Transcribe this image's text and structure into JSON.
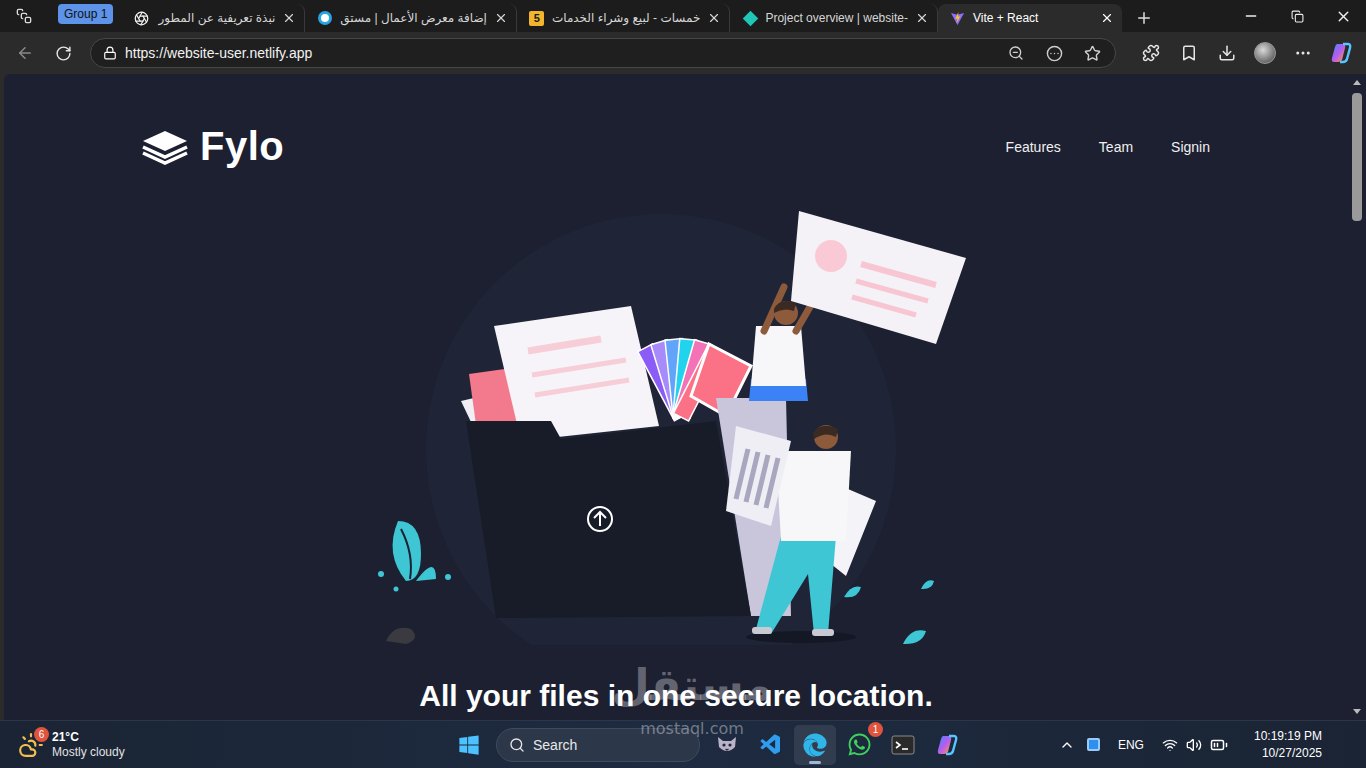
{
  "browser": {
    "tab_group": "Group 1",
    "tabs": [
      {
        "label": "نبذة تعريفية عن المطور",
        "kind": "chatgpt",
        "selected": false
      },
      {
        "label": "إضافة معرض الأعمال | مستق",
        "kind": "mostaql",
        "selected": false
      },
      {
        "label": "خمسات - لبيع وشراء الخدمات",
        "kind": "khamsat",
        "glyph": "5",
        "selected": false
      },
      {
        "label": "Project overview | website-",
        "kind": "netlify",
        "selected": false
      },
      {
        "label": "Vite + React",
        "kind": "vite",
        "selected": true
      }
    ],
    "address": "https://website-user.netlify.app",
    "scrollbar": {
      "level": 0.21
    }
  },
  "page": {
    "logo": "Fylo",
    "nav": [
      {
        "label": "Features"
      },
      {
        "label": "Team"
      },
      {
        "label": "Signin"
      }
    ],
    "headline": "All your files in one secure location."
  },
  "watermark": {
    "name": "مستقل",
    "site": "mostaql.com"
  },
  "taskbar": {
    "weather": {
      "badge": "6",
      "temperature": "21°C",
      "condition": "Mostly cloudy"
    },
    "search": {
      "placeholder": "Search"
    },
    "apps": [
      {
        "kind": "fox",
        "selected": false
      },
      {
        "kind": "vscode",
        "selected": false
      },
      {
        "kind": "edge",
        "selected": true
      },
      {
        "kind": "whatsapp",
        "selected": false,
        "badge": "1"
      },
      {
        "kind": "terminal",
        "selected": false
      },
      {
        "kind": "copilot",
        "selected": false
      }
    ],
    "language": "ENG",
    "time": "10:19:19 PM",
    "date": "10/27/2025"
  }
}
